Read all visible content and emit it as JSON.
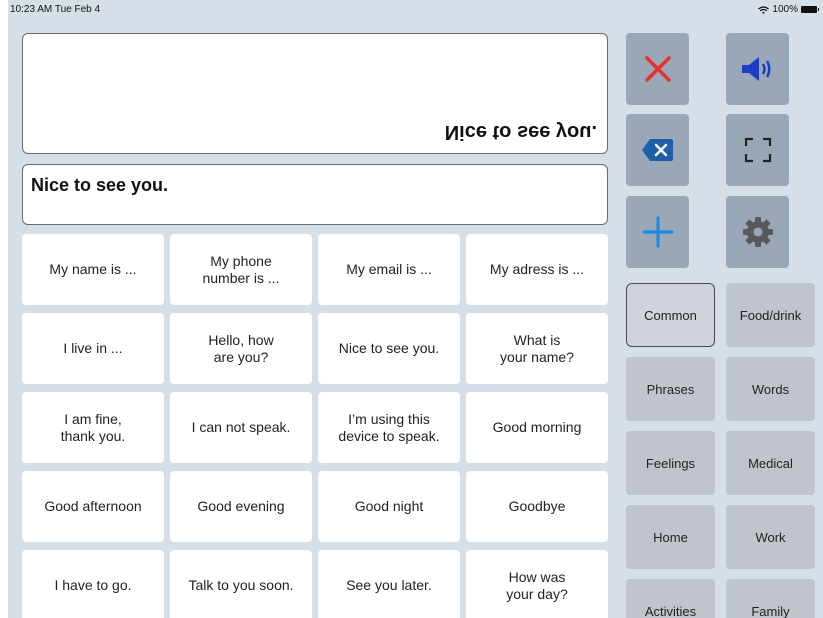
{
  "status": {
    "time": "10:23 AM  Tue Feb 4",
    "battery": "100%"
  },
  "display": {
    "flipped_text": "Nice to see you.",
    "input_text": "Nice to see you."
  },
  "phrases": [
    "My name is ...",
    "My phone\nnumber is ...",
    "My email is ...",
    "My adress is ...",
    "I live in ...",
    "Hello, how\nare you?",
    "Nice to see you.",
    "What is\nyour name?",
    "I am fine,\nthank you.",
    "I can not speak.",
    "I’m using this\ndevice to speak.",
    "Good morning",
    "Good afternoon",
    "Good evening",
    "Good night",
    "Goodbye",
    "I have to go.",
    "Talk to you soon.",
    "See you later.",
    "How was\nyour day?"
  ],
  "categories": {
    "common": "Common",
    "food_drink": "Food/drink",
    "phrases": "Phrases",
    "words": "Words",
    "feelings": "Feelings",
    "medical": "Medical",
    "home": "Home",
    "work": "Work",
    "activities": "Activities",
    "family": "Family"
  },
  "colors": {
    "clear": "#e8312f",
    "accent": "#1a5fd0",
    "plus": "#1e8ae6"
  },
  "icons": {
    "clear": "close-icon",
    "speak": "speaker-icon",
    "backspace": "backspace-icon",
    "fullscreen": "fullscreen-icon",
    "add": "plus-icon",
    "settings": "gear-icon"
  }
}
